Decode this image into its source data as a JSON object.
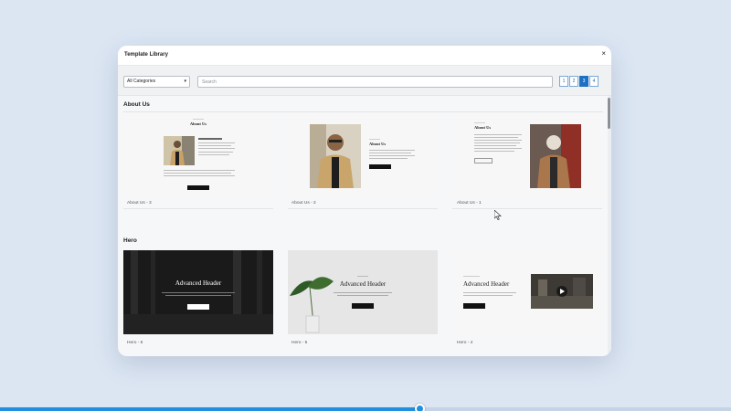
{
  "modal": {
    "title": "Template Library",
    "close_icon": "close-icon",
    "close_glyph": "×"
  },
  "toolbar": {
    "category_value": "All Categories",
    "search_placeholder": "Search",
    "pages": [
      "1",
      "2",
      "3",
      "4"
    ],
    "active_page": "3"
  },
  "sections": [
    {
      "title": "About Us",
      "cards": [
        {
          "label": "About Us - 3",
          "heading": "About Us"
        },
        {
          "label": "About Us - 2",
          "heading": "About Us"
        },
        {
          "label": "About Us - 1",
          "heading": "About Us"
        }
      ]
    },
    {
      "title": "Hero",
      "cards": [
        {
          "label": "Hero - 6",
          "heading": "Advanced Header"
        },
        {
          "label": "Hero - 5",
          "heading": "Advanced Header"
        },
        {
          "label": "Hero - 4",
          "heading": "Advanced Header"
        }
      ]
    }
  ],
  "video_progress": {
    "fraction": 0.575
  },
  "colors": {
    "accent": "#1f6fc2",
    "progress": "#1f8fe0",
    "background": "#dce6f3"
  }
}
